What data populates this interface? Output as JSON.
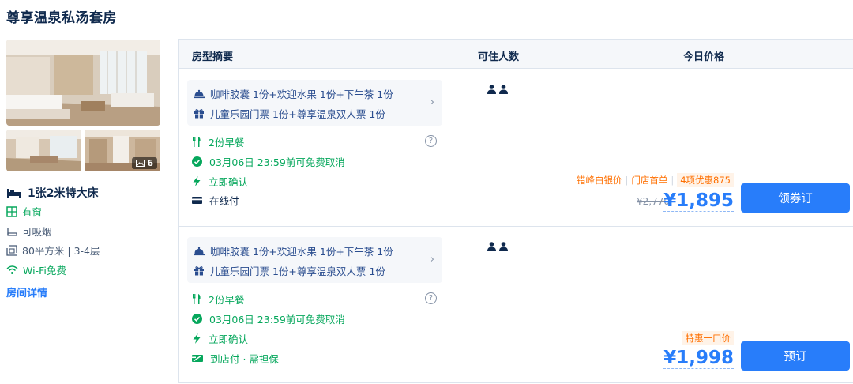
{
  "room": {
    "title": "尊享温泉私汤套房",
    "photo_count": "6",
    "bed": "1张2米特大床",
    "attributes": [
      {
        "label": "有窗",
        "icon": "window-icon",
        "highlight": true
      },
      {
        "label": "可吸烟",
        "icon": "smoking-icon",
        "highlight": false
      },
      {
        "label": "80平方米 | 3-4层",
        "icon": "area-icon",
        "highlight": false
      },
      {
        "label": "Wi-Fi免费",
        "icon": "wifi-icon",
        "highlight": true
      }
    ],
    "detail_link": "房间详情"
  },
  "table": {
    "headers": {
      "summary": "房型摘要",
      "occupancy": "可住人数",
      "price": "今日价格"
    }
  },
  "rates": [
    {
      "package_line1": "咖啡胶囊 1份+欢迎水果 1份+下午茶 1份",
      "package_line2": "儿童乐园门票 1份+尊享温泉双人票 1份",
      "breakfast": "2份早餐",
      "cancellation": "03月06日 23:59前可免费取消",
      "confirmation": "立即确认",
      "payment": "在线付",
      "promo_tags": [
        "错峰白银价",
        "门店首单",
        "4项优惠875"
      ],
      "original_price": "¥2,770",
      "price": "¥1,895",
      "button": "领券订"
    },
    {
      "package_line1": "咖啡胶囊 1份+欢迎水果 1份+下午茶 1份",
      "package_line2": "儿童乐园门票 1份+尊享温泉双人票 1份",
      "breakfast": "2份早餐",
      "cancellation": "03月06日 23:59前可免费取消",
      "confirmation": "立即确认",
      "payment": "到店付 · 需担保",
      "promo_tags": [
        "特惠一口价"
      ],
      "price": "¥1,998",
      "button": "预订"
    }
  ],
  "colors": {
    "accent": "#287dfa",
    "green": "#06a75c",
    "orange": "#ff6f00",
    "navy": "#0f294d"
  }
}
